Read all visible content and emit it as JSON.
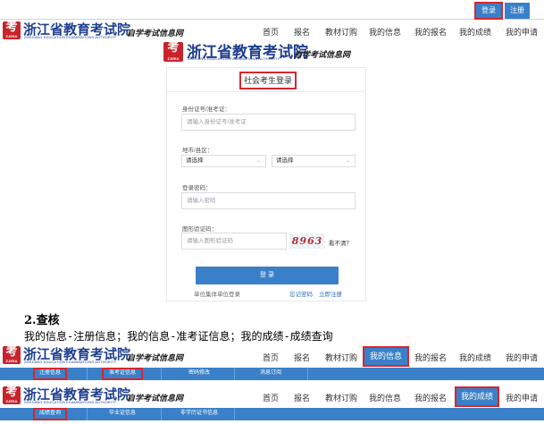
{
  "topbar": {
    "login": "登录",
    "register": "注册"
  },
  "logo": {
    "mark": "考",
    "mark_sub": "ZJEEA",
    "title": "浙江省教育考试院",
    "english": "ZHEJIANG EDUCATION EXAMINATIONS AUTHORITY",
    "subtitle": "自学考试信息网"
  },
  "nav": [
    "首页",
    "报名",
    "教材订购",
    "我的信息",
    "我的报名",
    "我的成绩",
    "我的申请"
  ],
  "login_card": {
    "title": "社会考生登录",
    "id_label": "身份证号/准考证：",
    "id_placeholder": "请输入身份证号/准考证",
    "region_label": "地市/县区：",
    "city_select": "请选择",
    "county_select": "请选择",
    "password_label": "登录密码：",
    "password_placeholder": "请输入密码",
    "captcha_label": "图形验证码：",
    "captcha_placeholder": "请输入图形验证码",
    "captcha_text": "8963",
    "captcha_refresh": "看不清？",
    "login_button": "登 录",
    "group_login": "单位集体单位登录",
    "forgot_password": "忘记密码",
    "register_now": "立即注册"
  },
  "section": {
    "heading": "2.查核",
    "text": "我的信息-注册信息；我的信息-准考证信息；我的成绩-成绩查询"
  },
  "subnav_info": [
    "注册信息",
    "准考证信息",
    "密码修改",
    "消息订阅"
  ],
  "subnav_score": [
    "成绩查询",
    "毕业证信息",
    "非学历证书信息"
  ]
}
